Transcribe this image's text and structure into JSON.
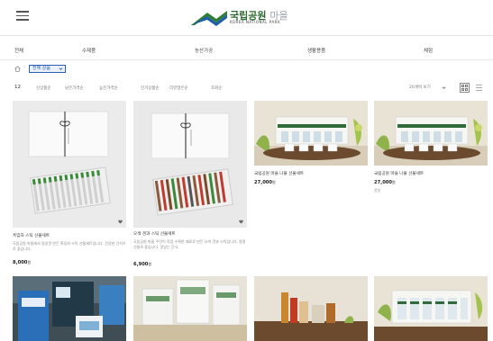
{
  "header": {
    "logo_text": "국립공원",
    "logo_text_light": "마을",
    "logo_sub": "KOREA NATIONAL PARK",
    "menu_icon": "hamburger-icon"
  },
  "categories": [
    "전체",
    "수제품",
    "농산가공",
    "생활용품",
    "체험"
  ],
  "breadcrumb": {
    "home_icon": "home-icon",
    "selected": "전체 상품"
  },
  "filter": {
    "count": "12",
    "sorts": [
      "신상품순",
      "낮은가격순",
      "높은가격순",
      "인기상품순",
      "리뷰많은순",
      "조회순"
    ],
    "view_option": "20개씩 보기",
    "grid_icon": "grid-view-icon",
    "list_icon": "list-view-icon"
  },
  "products": [
    {
      "name": "흑임자 스틱 선물세트",
      "desc": "국립공원 마을에서 정성껏 만든 흑임자 스틱 선물세트입니다. 건강한 간식으로 좋습니다.",
      "price": "8,000",
      "won": "원"
    },
    {
      "name": "오색 견과 스틱 선물세트",
      "desc": "국립공원 마을 주민이 직접 수확한 재료로 만든 오색 견과 스틱입니다. 명절 선물로 좋습니다. 맛있는 간식.",
      "price": "6,900",
      "won": "원"
    },
    {
      "name": "국립공원 마을 나물 선물세트",
      "price": "27,000",
      "won": "원"
    },
    {
      "name": "국립공원 마을 나물 선물세트",
      "price": "27,000",
      "won": "원",
      "badge": "품절"
    },
    {
      "name": ""
    },
    {
      "name": ""
    },
    {
      "name": ""
    },
    {
      "name": ""
    }
  ],
  "colors": {
    "accent": "#2b5fb5",
    "logo_green": "#2d6a30",
    "header_line": "#e6e6e6"
  }
}
